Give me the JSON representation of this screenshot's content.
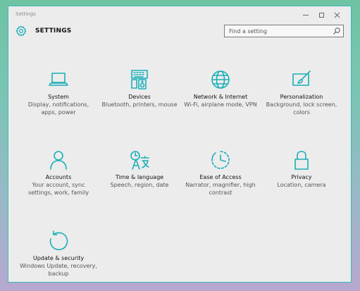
{
  "window": {
    "title": "Settings"
  },
  "header": {
    "title": "SETTINGS",
    "search_placeholder": "Find a setting"
  },
  "accent_color": "#1aaeb8",
  "tiles": [
    {
      "title": "System",
      "desc": "Display, notifications, apps, power",
      "icon": "laptop-icon"
    },
    {
      "title": "Devices",
      "desc": "Bluetooth, printers, mouse",
      "icon": "keyboard-speaker-icon"
    },
    {
      "title": "Network & Internet",
      "desc": "Wi-Fi, airplane mode, VPN",
      "icon": "globe-icon"
    },
    {
      "title": "Personalization",
      "desc": "Background, lock screen, colors",
      "icon": "paint-brush-icon"
    },
    {
      "title": "Accounts",
      "desc": "Your account, sync settings, work, family",
      "icon": "person-icon"
    },
    {
      "title": "Time & language",
      "desc": "Speech, region, date",
      "icon": "time-language-icon"
    },
    {
      "title": "Ease of Access",
      "desc": "Narrator, magnifier, high contrast",
      "icon": "ease-of-access-icon"
    },
    {
      "title": "Privacy",
      "desc": "Location, camera",
      "icon": "lock-icon"
    },
    {
      "title": "Update & security",
      "desc": "Windows Update, recovery, backup",
      "icon": "refresh-icon"
    }
  ]
}
